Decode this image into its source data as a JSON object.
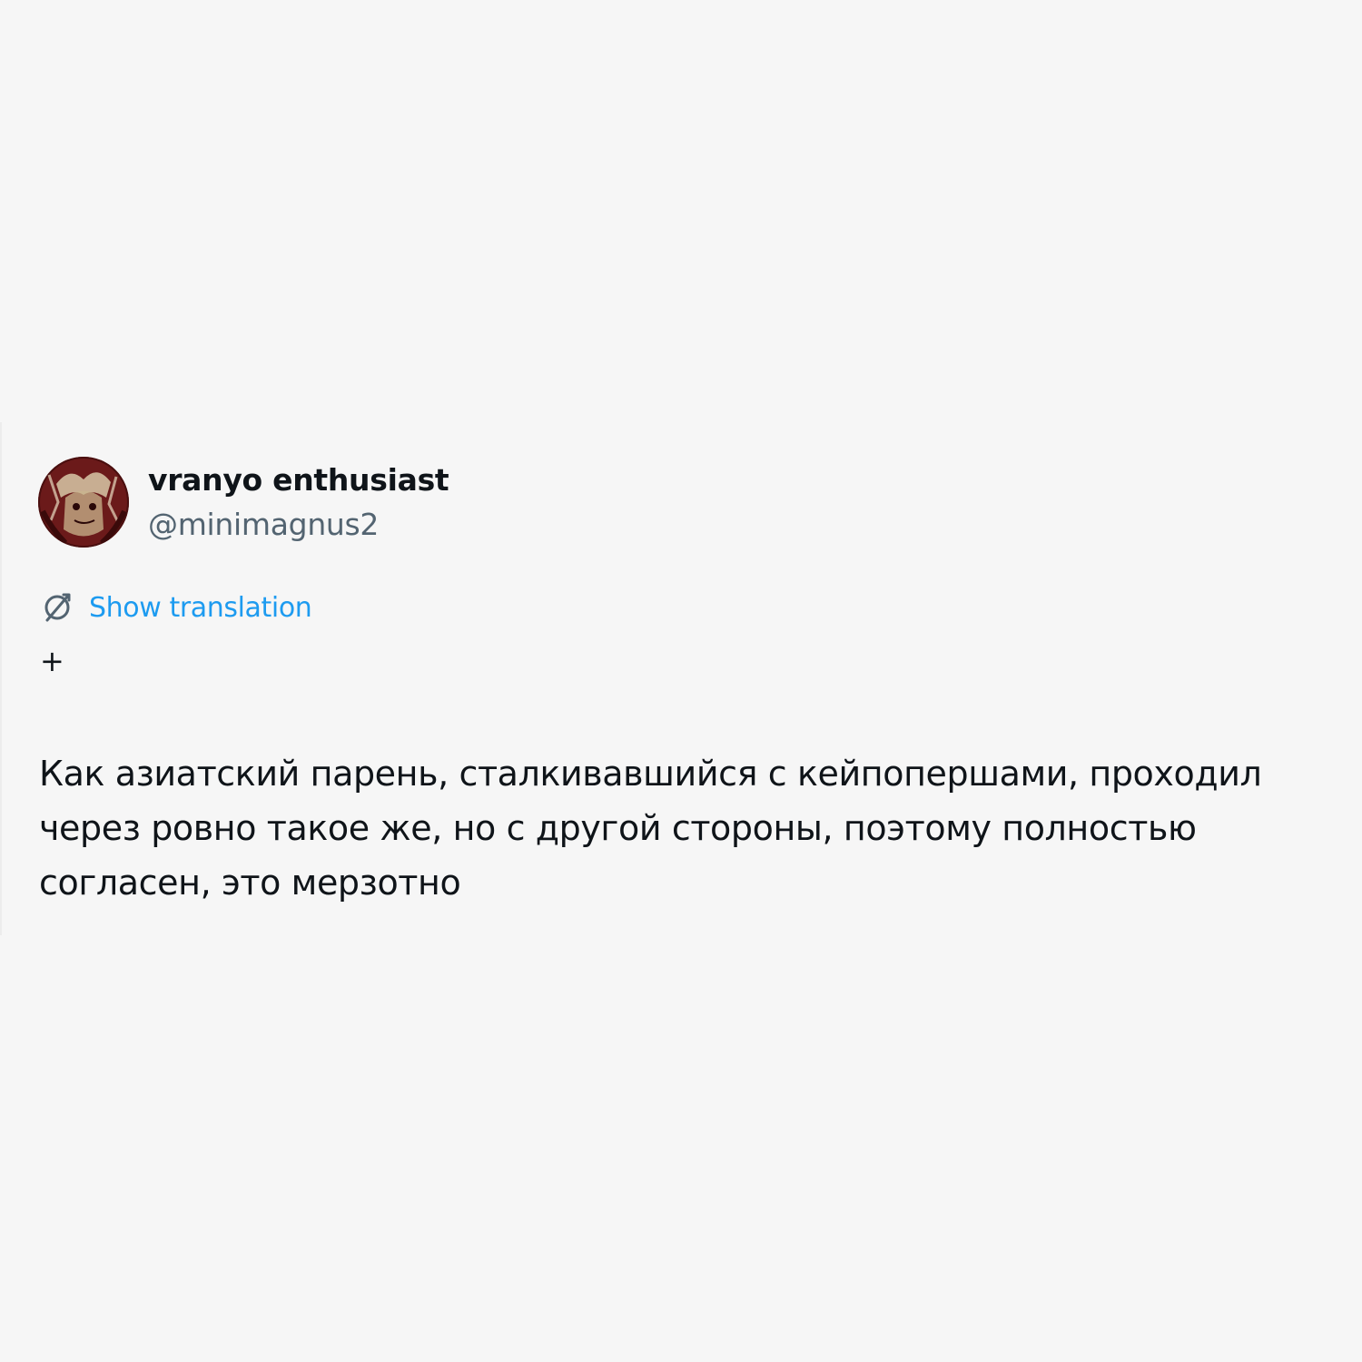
{
  "tweet": {
    "author": {
      "display_name": "vranyo enthusiast",
      "handle": "@minimagnus2",
      "avatar_icon": "avatar-image"
    },
    "translate": {
      "icon": "translate-icon",
      "label": "Show translation"
    },
    "plus": "+",
    "text_lines": [
      "Как азиатский парень, сталкивавшийся с кейпопершами, проходил",
      "через ровно такое же, но с другой стороны, поэтому полностью",
      "согласен, это мерзотно"
    ]
  },
  "colors": {
    "background": "#f6f6f6",
    "text": "#0f1419",
    "secondary_text": "#536471",
    "link": "#1d9bf0"
  }
}
